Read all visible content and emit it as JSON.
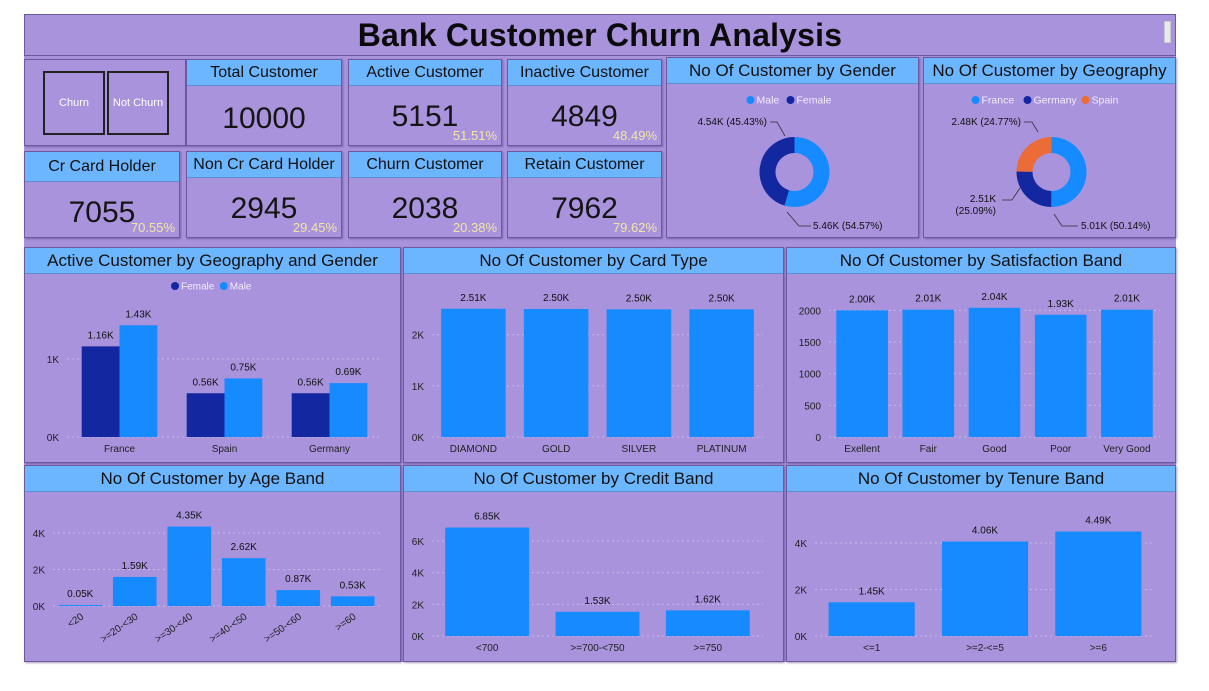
{
  "title": "Bank Customer Churn Analysis",
  "slicer": {
    "churn_label": "Churn",
    "not_churn_label": "Not Churn"
  },
  "kpis": {
    "total": {
      "label": "Total Customer",
      "value": "10000"
    },
    "active": {
      "label": "Active Customer",
      "value": "5151",
      "pct": "51.51%"
    },
    "inactive": {
      "label": "Inactive Customer",
      "value": "4849",
      "pct": "48.49%"
    },
    "cc_holder": {
      "label": "Cr Card Holder",
      "value": "7055",
      "pct": "70.55%"
    },
    "non_cc": {
      "label": "Non Cr Card Holder",
      "value": "2945",
      "pct": "29.45%"
    },
    "churn": {
      "label": "Churn Customer",
      "value": "2038",
      "pct": "20.38%"
    },
    "retain": {
      "label": "Retain Customer",
      "value": "7962",
      "pct": "79.62%"
    }
  },
  "colors": {
    "dark_blue": "#1227a0",
    "blue": "#168bff",
    "orange": "#ec6c37",
    "header": "#6cb6ff",
    "panel": "#a893dc",
    "pct_text": "#f3e6a4"
  },
  "chart_data": [
    {
      "id": "gender",
      "type": "pie",
      "title": "No Of Customer by Gender",
      "legend": [
        "Male",
        "Female"
      ],
      "legend_position": "top",
      "values": [
        5.46,
        4.54
      ],
      "data_labels": [
        "5.46K (54.57%)",
        "4.54K (45.43%)"
      ],
      "colors": [
        "#168bff",
        "#1227a0"
      ]
    },
    {
      "id": "geography",
      "type": "pie",
      "title": "No Of Customer by Geography",
      "legend": [
        "France",
        "Germany",
        "Spain"
      ],
      "legend_position": "top",
      "values": [
        5.01,
        2.51,
        2.48
      ],
      "data_labels": [
        "5.01K (50.14%)",
        "2.51K (25.09%)",
        "2.48K (24.77%)"
      ],
      "colors": [
        "#168bff",
        "#1227a0",
        "#ec6c37"
      ]
    },
    {
      "id": "geo_gender",
      "type": "bar",
      "title": "Active Customer by Geography and Gender",
      "categories": [
        "France",
        "Spain",
        "Germany"
      ],
      "series": [
        {
          "name": "Female",
          "values": [
            1.16,
            0.56,
            0.56
          ],
          "labels": [
            "1.16K",
            "0.56K",
            "0.56K"
          ]
        },
        {
          "name": "Male",
          "values": [
            1.43,
            0.75,
            0.69
          ],
          "labels": [
            "1.43K",
            "0.75K",
            "0.69K"
          ]
        }
      ],
      "yticks": [
        "0K",
        "1K"
      ],
      "ylim": [
        0,
        1.6
      ],
      "grid": true,
      "legend_position": "top"
    },
    {
      "id": "card",
      "type": "bar",
      "title": "No Of Customer by Card Type",
      "categories": [
        "DIAMOND",
        "GOLD",
        "SILVER",
        "PLATINUM"
      ],
      "values": [
        2507,
        2502,
        2496,
        2495
      ],
      "labels": [
        "2.51K",
        "2.50K",
        "2.50K",
        "2.50K"
      ],
      "yticks": [
        "0K",
        "1K",
        "2K"
      ],
      "ylim": [
        0,
        2600
      ],
      "grid": true
    },
    {
      "id": "satisfaction",
      "type": "bar",
      "title": "No Of Customer by Satisfaction Band",
      "categories": [
        "Exellent",
        "Fair",
        "Good",
        "Poor",
        "Very Good"
      ],
      "values": [
        2000,
        2010,
        2040,
        1930,
        2010
      ],
      "labels": [
        "2.00K",
        "2.01K",
        "2.04K",
        "1.93K",
        "2.01K"
      ],
      "yticks": [
        "0",
        "500",
        "1000",
        "1500",
        "2000"
      ],
      "ylim": [
        0,
        2100
      ],
      "grid": true
    },
    {
      "id": "age",
      "type": "bar",
      "title": "No Of Customer by Age Band",
      "categories": [
        "<20",
        ">=20-<30",
        ">=30-<40",
        ">=40-<50",
        ">=50-<60",
        ">=60"
      ],
      "values": [
        0.05,
        1.59,
        4.35,
        2.62,
        0.87,
        0.53
      ],
      "labels": [
        "0.05K",
        "1.59K",
        "4.35K",
        "2.62K",
        "0.87K",
        "0.53K"
      ],
      "yticks": [
        "0K",
        "2K",
        "4K"
      ],
      "ylim": [
        0,
        4.6
      ],
      "grid": true
    },
    {
      "id": "credit",
      "type": "bar",
      "title": "No Of Customer by Credit Band",
      "categories": [
        "<700",
        ">=700-<750",
        ">=750"
      ],
      "values": [
        6.85,
        1.53,
        1.62
      ],
      "labels": [
        "6.85K",
        "1.53K",
        "1.62K"
      ],
      "yticks": [
        "0K",
        "2K",
        "4K",
        "6K"
      ],
      "ylim": [
        0,
        7.2
      ],
      "grid": true
    },
    {
      "id": "tenure",
      "type": "bar",
      "title": "No Of Customer by Tenure Band",
      "categories": [
        "<=1",
        ">=2-<=5",
        ">=6"
      ],
      "values": [
        1.45,
        4.06,
        4.49
      ],
      "labels": [
        "1.45K",
        "4.06K",
        "4.49K"
      ],
      "yticks": [
        "0K",
        "2K",
        "4K"
      ],
      "ylim": [
        0,
        4.9
      ],
      "grid": true
    }
  ]
}
